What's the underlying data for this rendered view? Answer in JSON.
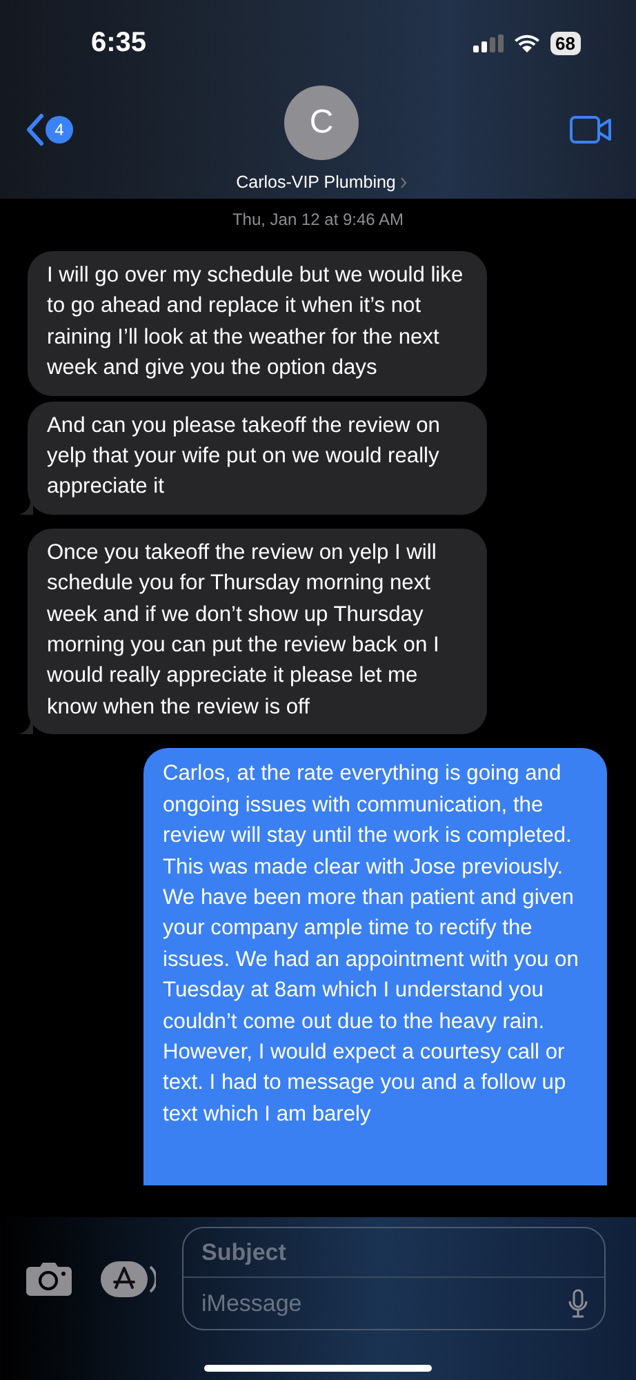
{
  "status_bar": {
    "time": "6:35",
    "battery": "68"
  },
  "header": {
    "back_badge": "4",
    "avatar_initial": "C",
    "contact_name": "Carlos-VIP Plumbing"
  },
  "timestamp": "Thu, Jan 12 at 9:46 AM",
  "messages": [
    {
      "kind": "received",
      "tail": false,
      "text": "I will go over my schedule but we would like to go ahead and replace it when it’s not raining I’ll look at the weather for the next week and give you the option days"
    },
    {
      "kind": "received",
      "tail": true,
      "text": "And can you please takeoff the review on yelp that your wife put on we would really appreciate it"
    },
    {
      "kind": "received",
      "tail": true,
      "text": "Once you takeoff the review on yelp I will schedule you for Thursday morning next week and if we don’t show up Thursday morning you can put the review back on I would really appreciate it please let me know when the review is off"
    },
    {
      "kind": "sent",
      "tail": false,
      "text": "Carlos, at the rate everything is going and ongoing issues with communication, the review will stay until the work is completed. This was made clear with Jose previously. We have been more than patient and given your company ample time to rectify the issues. We had an appointment with you on Tuesday at 8am which I understand you couldn’t come out due to the heavy rain. However, I would expect a courtesy call or text. I had to message you and a follow up text which I am barely"
    }
  ],
  "composer": {
    "subject_placeholder": "Subject",
    "message_placeholder": "iMessage"
  }
}
